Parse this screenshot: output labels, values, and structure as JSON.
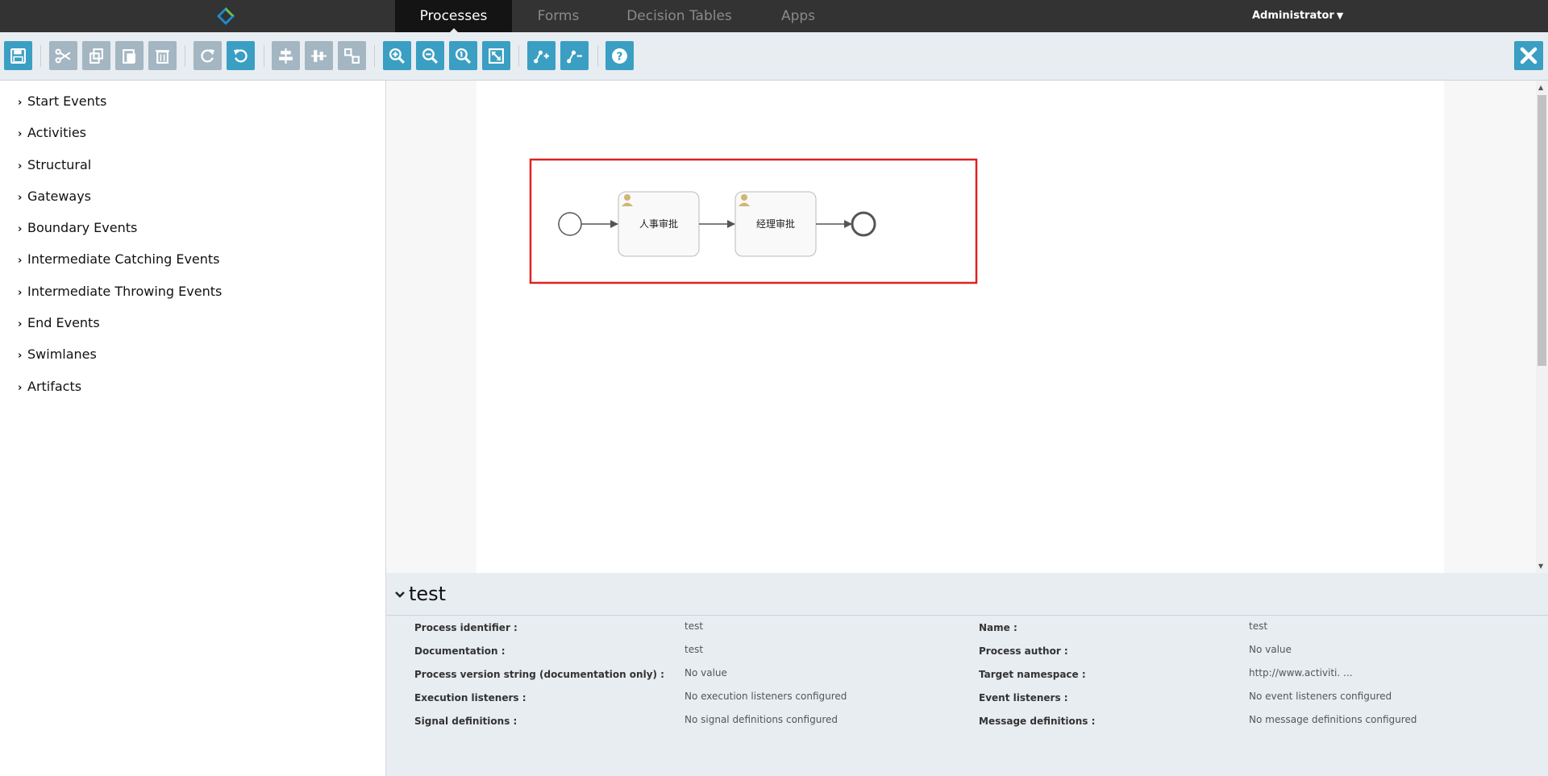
{
  "nav": {
    "tabs": [
      {
        "label": "Processes",
        "active": true
      },
      {
        "label": "Forms",
        "active": false
      },
      {
        "label": "Decision Tables",
        "active": false
      },
      {
        "label": "Apps",
        "active": false
      }
    ],
    "user": "Administrator"
  },
  "toolbar": {
    "groups": [
      [
        "save-icon"
      ],
      [
        "cut-icon",
        "copy-icon",
        "paste-icon",
        "delete-icon"
      ],
      [
        "redo-icon",
        "undo-icon"
      ],
      [
        "align-horizontal-icon",
        "align-vertical-icon",
        "same-size-icon"
      ],
      [
        "zoom-in-icon",
        "zoom-out-icon",
        "zoom-actual-icon",
        "zoom-fit-icon"
      ],
      [
        "add-bendpoint-icon",
        "remove-bendpoint-icon"
      ],
      [
        "help-icon"
      ]
    ],
    "close_icon": "close-icon"
  },
  "palette": {
    "items": [
      "Start Events",
      "Activities",
      "Structural",
      "Gateways",
      "Boundary Events",
      "Intermediate Catching Events",
      "Intermediate Throwing Events",
      "End Events",
      "Swimlanes",
      "Artifacts"
    ]
  },
  "diagram": {
    "tasks": [
      {
        "label": "人事审批",
        "icon": "user-icon"
      },
      {
        "label": "经理审批",
        "icon": "user-icon"
      }
    ],
    "highlight_color": "#e02020"
  },
  "properties": {
    "title": "test",
    "left": [
      {
        "label": "Process identifier :",
        "value": "test"
      },
      {
        "label": "Documentation :",
        "value": "test"
      },
      {
        "label": "Process version string (documentation only) :",
        "value": "No value"
      },
      {
        "label": "Execution listeners :",
        "value": "No execution listeners configured"
      },
      {
        "label": "Signal definitions :",
        "value": "No signal definitions configured"
      }
    ],
    "right": [
      {
        "label": "Name :",
        "value": "test"
      },
      {
        "label": "Process author :",
        "value": "No value"
      },
      {
        "label": "Target namespace :",
        "value": "http://www.activiti. ..."
      },
      {
        "label": "Event listeners :",
        "value": "No event listeners configured"
      },
      {
        "label": "Message definitions :",
        "value": "No message definitions configured"
      }
    ]
  },
  "colors": {
    "accent": "#3a9fc3",
    "topbar": "#333333",
    "toolbar_bg": "#e8edf2"
  }
}
